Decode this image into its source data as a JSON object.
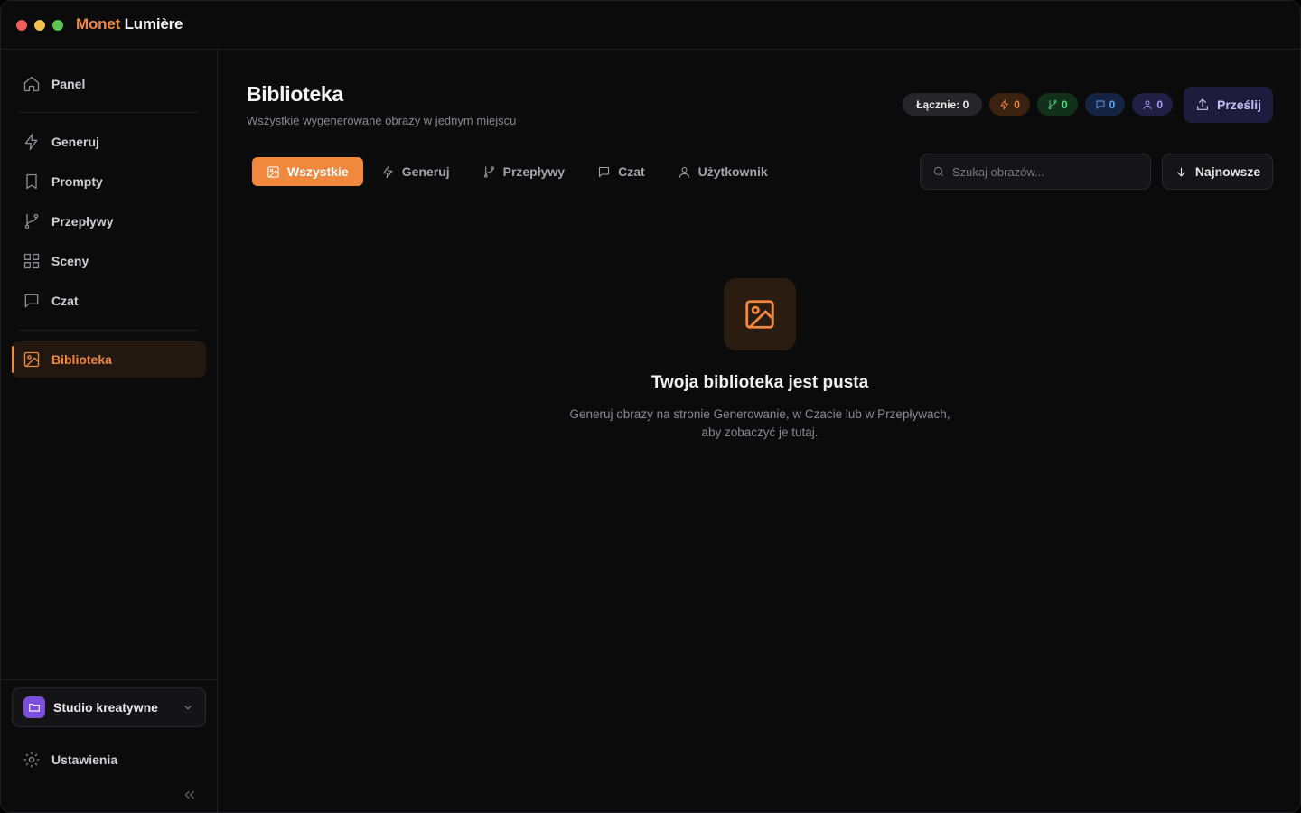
{
  "app": {
    "brand_part1": "Monet",
    "brand_part2": "Lumière",
    "accent": "#f0883e"
  },
  "sidebar": {
    "items": [
      {
        "label": "Panel",
        "icon": "home-icon"
      },
      {
        "label": "Generuj",
        "icon": "bolt-icon"
      },
      {
        "label": "Prompty",
        "icon": "bookmark-icon"
      },
      {
        "label": "Przepływy",
        "icon": "git-branch-icon"
      },
      {
        "label": "Sceny",
        "icon": "grid-icon"
      },
      {
        "label": "Czat",
        "icon": "chat-icon"
      },
      {
        "label": "Biblioteka",
        "icon": "image-icon",
        "active": true
      }
    ],
    "workspace": "Studio kreatywne",
    "settings": "Ustawienia"
  },
  "header": {
    "title": "Biblioteka",
    "subtitle": "Wszystkie wygenerowane obrazy w jednym miejscu",
    "badges": {
      "total": "Łącznie: 0",
      "generated": "0",
      "flows": "0",
      "chat": "0",
      "user": "0"
    },
    "upload_label": "Prześlij"
  },
  "tabs": [
    {
      "label": "Wszystkie",
      "icon": "image-icon",
      "active": true
    },
    {
      "label": "Generuj",
      "icon": "bolt-icon"
    },
    {
      "label": "Przepływy",
      "icon": "git-branch-icon"
    },
    {
      "label": "Czat",
      "icon": "chat-icon"
    },
    {
      "label": "Użytkownik",
      "icon": "user-icon"
    }
  ],
  "search": {
    "placeholder": "Szukaj obrazów...",
    "value": ""
  },
  "sort": {
    "label": "Najnowsze"
  },
  "empty_state": {
    "title": "Twoja biblioteka jest pusta",
    "description_line1": "Generuj obrazy na stronie Generowanie, w Czacie lub w Przepływach,",
    "description_line2": "aby zobaczyć je tutaj."
  }
}
